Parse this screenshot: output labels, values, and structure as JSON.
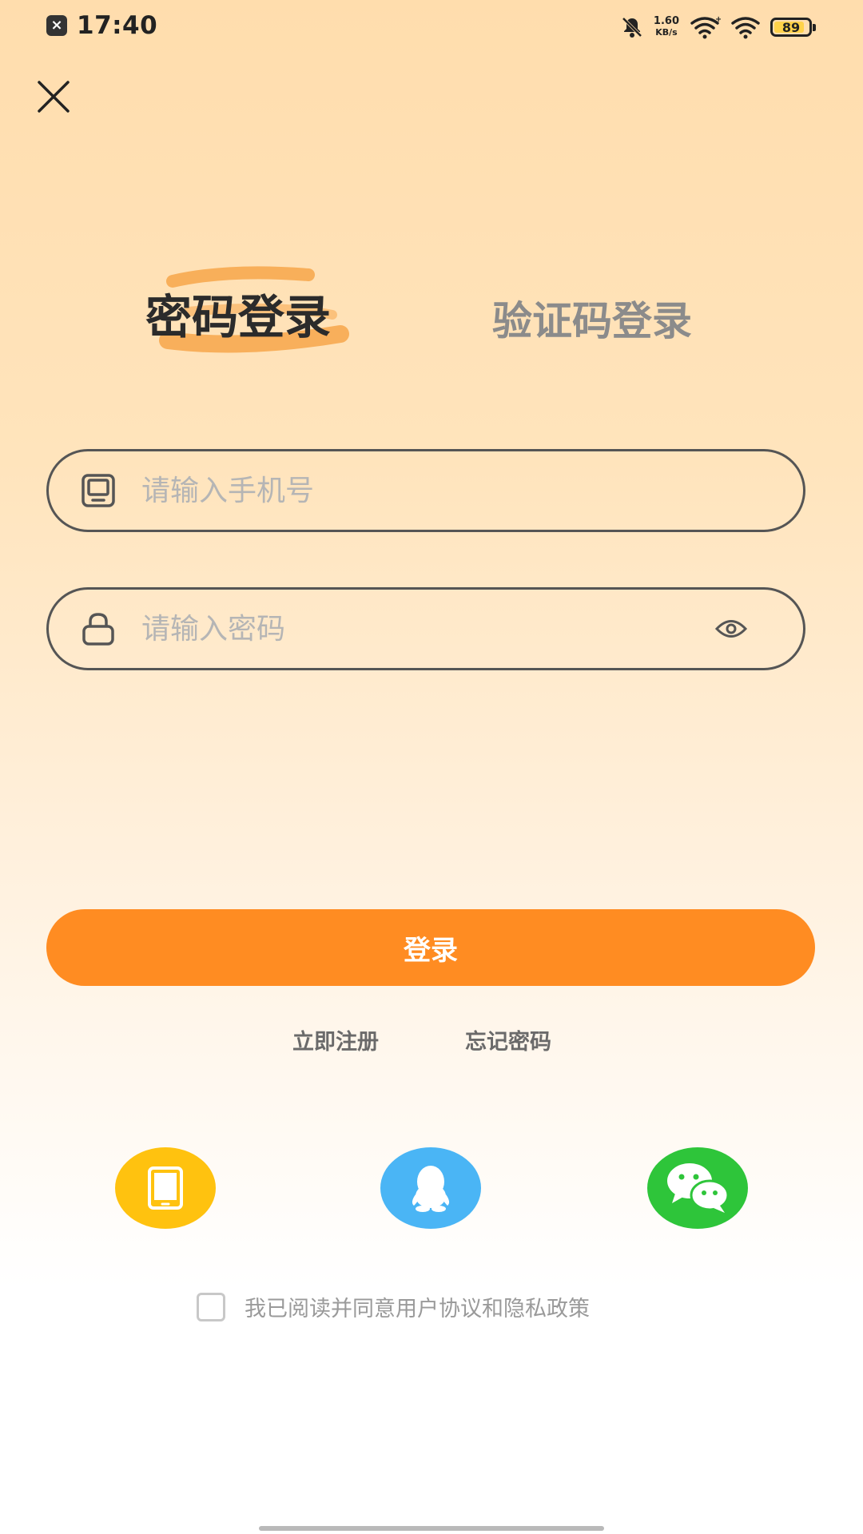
{
  "status_bar": {
    "time": "17:40",
    "net_speed_value": "1.60",
    "net_speed_unit": "KB/s",
    "battery_level": "89",
    "battery_fraction": 0.89
  },
  "tabs": {
    "password_login": "密码登录",
    "code_login": "验证码登录"
  },
  "form": {
    "phone_placeholder": "请输入手机号",
    "password_placeholder": "请输入密码"
  },
  "login_button": "登录",
  "links": {
    "register": "立即注册",
    "forgot_password": "忘记密码"
  },
  "agreement": {
    "text": "我已阅读并同意用户协议和隐私政策"
  },
  "colors": {
    "accent": "#ff8c22",
    "highlight": "#f7a64a",
    "social_tablet": "#ffc20f",
    "social_qq": "#4ab5f5",
    "social_wechat": "#2ec53a"
  },
  "icons": [
    "close-icon",
    "phone-icon",
    "lock-icon",
    "eye-icon",
    "tablet-icon",
    "qq-icon",
    "wechat-icon"
  ]
}
